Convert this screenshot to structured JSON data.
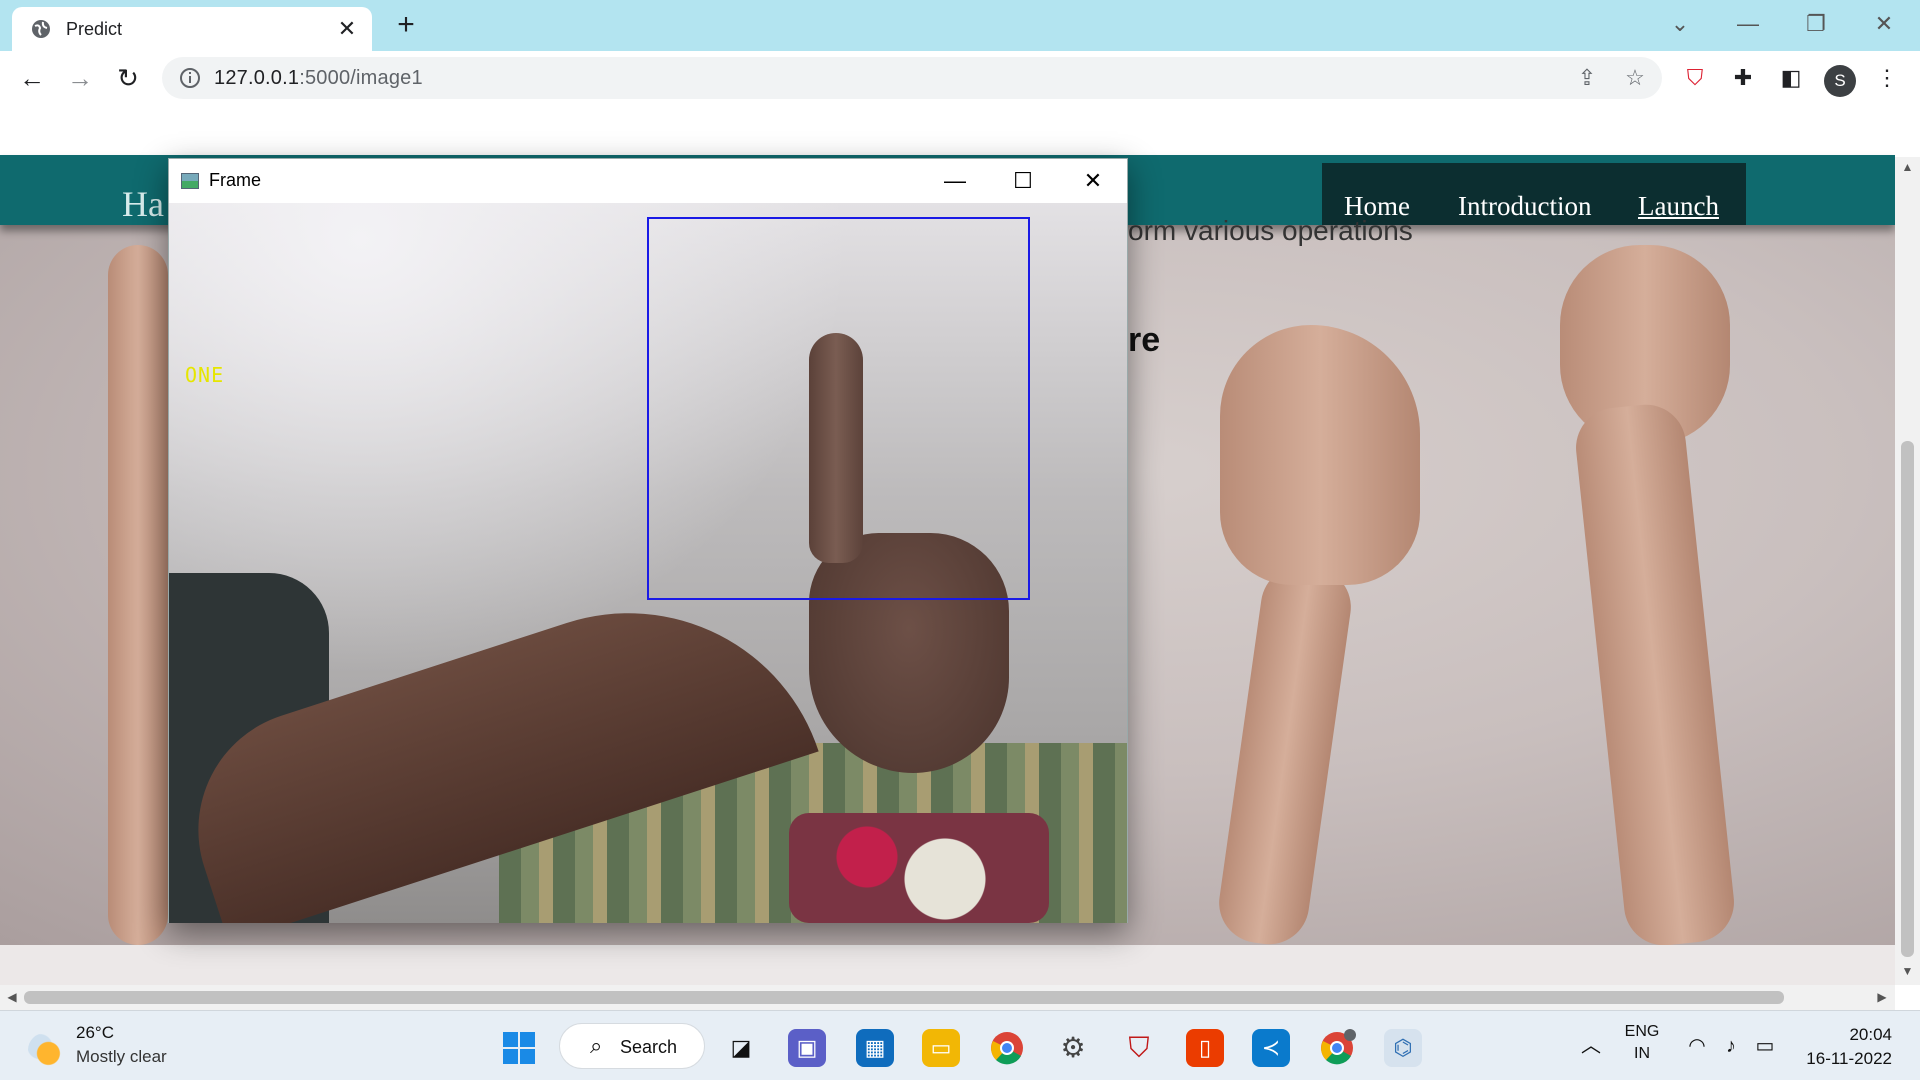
{
  "browser": {
    "tab": {
      "title": "Predict"
    },
    "address_bar": {
      "host": "127.0.0.1",
      "path": ":5000/image1"
    },
    "profile_initial": "S",
    "icons": [
      "globe-icon",
      "close-icon",
      "plus-icon",
      "back-icon",
      "forward-icon",
      "reload-icon",
      "info-icon",
      "share-icon",
      "star-icon",
      "extension-icon",
      "puzzle-icon",
      "sidepanel-icon",
      "kebab-menu-icon"
    ]
  },
  "page": {
    "site_title_visible": "Ha",
    "nav": {
      "home": "Home",
      "introduction": "Introduction",
      "launch": "Launch"
    },
    "text_fragment": "orm various operations",
    "heading_fragment": "re",
    "navbar_color": "#0f6a6e"
  },
  "frame_window": {
    "title": "Frame",
    "prediction": "ONE",
    "roi_color": "#1a1ae6",
    "prediction_color": "#e6e600"
  },
  "taskbar": {
    "weather": {
      "temp": "26°C",
      "desc": "Mostly clear"
    },
    "search_label": "Search",
    "language": {
      "line1": "ENG",
      "line2": "IN"
    },
    "clock": {
      "time": "20:04",
      "date": "16-11-2022"
    },
    "apps": [
      "windows-start",
      "task-view",
      "teams-chat",
      "microsoft-store",
      "file-explorer",
      "chrome",
      "settings",
      "mcafee",
      "office",
      "vscode",
      "chrome-profile",
      "python"
    ]
  }
}
